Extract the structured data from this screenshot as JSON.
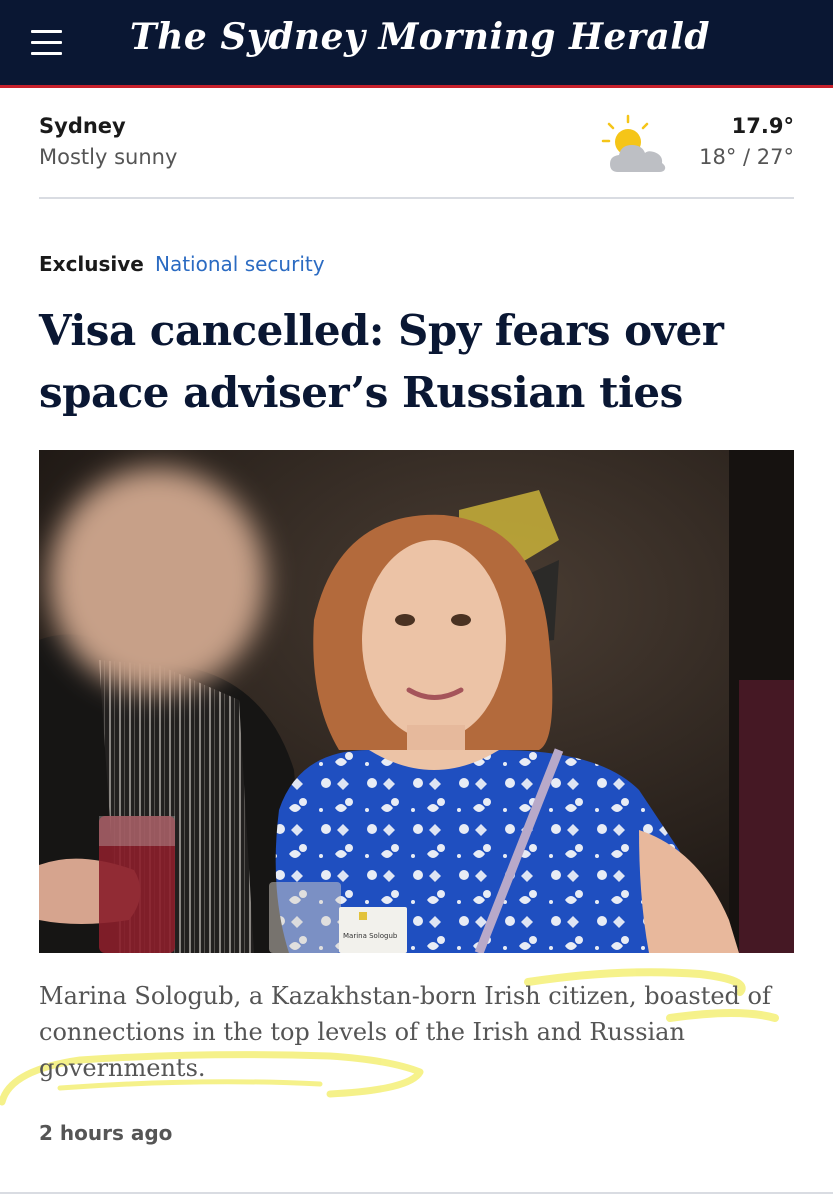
{
  "masthead": {
    "title": "The Sydney Morning Herald",
    "menu_icon": "hamburger-menu-icon",
    "brand_color": "#0a1733",
    "accent_rule_color": "#c8202b"
  },
  "weather": {
    "city": "Sydney",
    "condition": "Mostly sunny",
    "icon": "partly-sunny-icon",
    "current_temp": "17.9°",
    "range": "18° / 27°"
  },
  "article": {
    "kicker_label": "Exclusive",
    "topic": "National security",
    "topic_color": "#2b6bc2",
    "headline_lines": [
      "Visa cancelled: Spy fears over",
      "space adviser’s Russian ties"
    ],
    "photo": {
      "description_icon": "article-photo",
      "name_tag": "Marina Sologub"
    },
    "caption": "Marina Sologub, a Kazakhstan-born Irish citizen, boasted of connections in the top levels of the Irish and Russian governments.",
    "highlight_color": "#f3ee6a",
    "timestamp": "2 hours ago"
  }
}
